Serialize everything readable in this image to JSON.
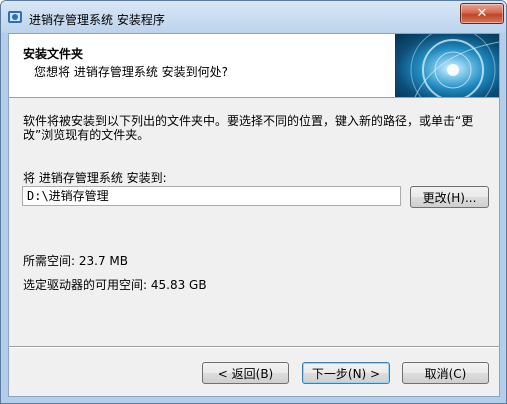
{
  "window": {
    "title": "进销存管理系统 安装程序",
    "close_glyph": "✕"
  },
  "header": {
    "title": "安装文件夹",
    "subtitle": "您想将 进销存管理系统 安装到何处?"
  },
  "main": {
    "description": "软件将被安装到以下列出的文件夹中。要选择不同的位置，键入新的路径，或单击“更改”浏览现有的文件夹。",
    "install_label": "将 进销存管理系统 安装到:",
    "path_value": "D:\\进销存管理",
    "browse_label": "更改(H)...",
    "space_required": "所需空间: 23.7 MB",
    "space_available": "选定驱动器的可用空间: 45.83 GB"
  },
  "footer": {
    "back_label": "< 返回(B)",
    "next_label": "下一步(N) >",
    "cancel_label": "取消(C)"
  },
  "icons": {
    "title_icon": "installer-icon",
    "header_image": "disc-image"
  }
}
